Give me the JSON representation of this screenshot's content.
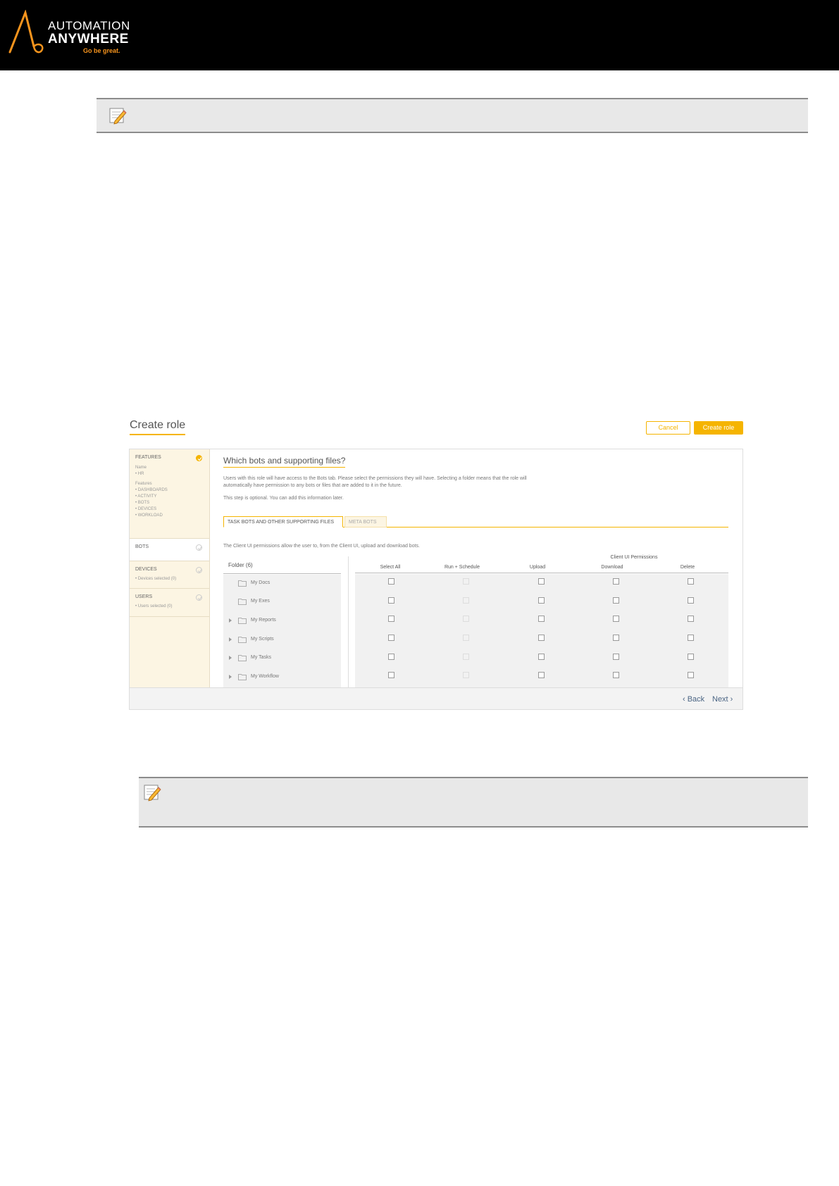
{
  "header": {
    "logo_line1": "AUTOMATION",
    "logo_line2": "ANYWHERE",
    "tagline": "Go be great."
  },
  "colors": {
    "accent": "#f5b400",
    "banner": "#000000",
    "sidebar_bg": "#fcf5e3",
    "note_bg": "#e8e8e8"
  },
  "notes": [
    {
      "icon": "pencil-note-icon"
    },
    {
      "icon": "pencil-note-icon"
    }
  ],
  "app": {
    "title": "Create role",
    "cancel_label": "Cancel",
    "create_label": "Create role",
    "sidebar": {
      "features": {
        "title": "FEATURES",
        "name_label": "Name",
        "name_value": "• HR",
        "features_label": "Features",
        "items": [
          "• DASHBOARDS",
          "• ACTIVITY",
          "• BOTS",
          "• DEVICES",
          "• WORKLOAD"
        ]
      },
      "bots": {
        "title": "BOTS"
      },
      "devices": {
        "title": "DEVICES",
        "detail": "• Devices selected (0)"
      },
      "users": {
        "title": "USERS",
        "detail": "• Users selected (0)"
      }
    },
    "main": {
      "heading": "Which bots and supporting files?",
      "description_line1": "Users with this role will have access to the Bots tab. Please select the permissions they will have. Selecting a folder means that the role will",
      "description_line2": "automatically have permission to any bots or files that are added to it in the future.",
      "optional_note": "This step is optional. You can add this information later.",
      "tabs": [
        {
          "label": "TASK BOTS AND OTHER SUPPORTING FILES",
          "active": true
        },
        {
          "label": "META BOTS",
          "active": false
        }
      ],
      "client_ui_note": "The Client UI permissions allow the user to, from the Client UI, upload and download bots.",
      "folder_header": "Folder (6)",
      "permissions_group": "Client UI Permissions",
      "columns": [
        "Select All",
        "Run + Schedule",
        "Upload",
        "Download",
        "Delete"
      ],
      "folders": [
        {
          "name": "My Docs",
          "expandable": false
        },
        {
          "name": "My Exes",
          "expandable": false
        },
        {
          "name": "My Reports",
          "expandable": true
        },
        {
          "name": "My Scripts",
          "expandable": true
        },
        {
          "name": "My Tasks",
          "expandable": true
        },
        {
          "name": "My Workflow",
          "expandable": true
        }
      ]
    },
    "footer": {
      "back_label": "‹ Back",
      "next_label": "Next ›"
    }
  }
}
